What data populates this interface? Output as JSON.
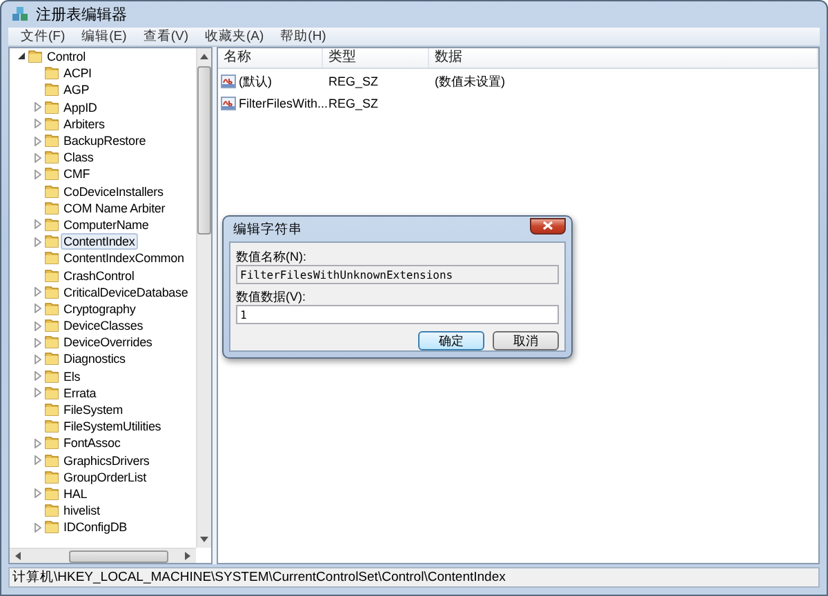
{
  "window": {
    "title": "注册表编辑器"
  },
  "menu": [
    "文件(F)",
    "编辑(E)",
    "查看(V)",
    "收藏夹(A)",
    "帮助(H)"
  ],
  "tree": [
    {
      "label": "Control",
      "expanded": true,
      "selected": false,
      "children": [
        {
          "label": "ACPI",
          "expandable": false,
          "selected": false
        },
        {
          "label": "AGP",
          "expandable": false,
          "selected": false
        },
        {
          "label": "AppID",
          "expandable": true,
          "selected": false
        },
        {
          "label": "Arbiters",
          "expandable": true,
          "selected": false
        },
        {
          "label": "BackupRestore",
          "expandable": true,
          "selected": false
        },
        {
          "label": "Class",
          "expandable": true,
          "selected": false
        },
        {
          "label": "CMF",
          "expandable": true,
          "selected": false
        },
        {
          "label": "CoDeviceInstallers",
          "expandable": false,
          "selected": false
        },
        {
          "label": "COM Name Arbiter",
          "expandable": false,
          "selected": false
        },
        {
          "label": "ComputerName",
          "expandable": true,
          "selected": false
        },
        {
          "label": "ContentIndex",
          "expandable": true,
          "selected": true
        },
        {
          "label": "ContentIndexCommon",
          "expandable": false,
          "selected": false
        },
        {
          "label": "CrashControl",
          "expandable": false,
          "selected": false
        },
        {
          "label": "CriticalDeviceDatabase",
          "expandable": true,
          "selected": false
        },
        {
          "label": "Cryptography",
          "expandable": true,
          "selected": false
        },
        {
          "label": "DeviceClasses",
          "expandable": true,
          "selected": false
        },
        {
          "label": "DeviceOverrides",
          "expandable": true,
          "selected": false
        },
        {
          "label": "Diagnostics",
          "expandable": true,
          "selected": false
        },
        {
          "label": "Els",
          "expandable": true,
          "selected": false
        },
        {
          "label": "Errata",
          "expandable": true,
          "selected": false
        },
        {
          "label": "FileSystem",
          "expandable": false,
          "selected": false
        },
        {
          "label": "FileSystemUtilities",
          "expandable": false,
          "selected": false
        },
        {
          "label": "FontAssoc",
          "expandable": true,
          "selected": false
        },
        {
          "label": "GraphicsDrivers",
          "expandable": true,
          "selected": false
        },
        {
          "label": "GroupOrderList",
          "expandable": false,
          "selected": false
        },
        {
          "label": "HAL",
          "expandable": true,
          "selected": false
        },
        {
          "label": "hivelist",
          "expandable": false,
          "selected": false
        },
        {
          "label": "IDConfigDB",
          "expandable": true,
          "selected": false
        }
      ]
    }
  ],
  "table": {
    "columns": [
      "名称",
      "类型",
      "数据"
    ],
    "rows": [
      {
        "name": "(默认)",
        "type": "REG_SZ",
        "data": "(数值未设置)"
      },
      {
        "name": "FilterFilesWith...",
        "type": "REG_SZ"
      }
    ]
  },
  "dialog": {
    "title": "编辑字符串",
    "fields": [
      {
        "label": "数值名称(N):",
        "value": "FilterFilesWithUnknownExtensions",
        "readonly": true
      },
      {
        "label": "数值数据(V):",
        "value": "1",
        "readonly": false
      }
    ],
    "buttons": [
      {
        "label": "确定",
        "default": true
      },
      {
        "label": "取消",
        "default": false
      }
    ]
  },
  "status_bar": "计算机\\HKEY_LOCAL_MACHINE\\SYSTEM\\CurrentControlSet\\Control\\ContentIndex"
}
